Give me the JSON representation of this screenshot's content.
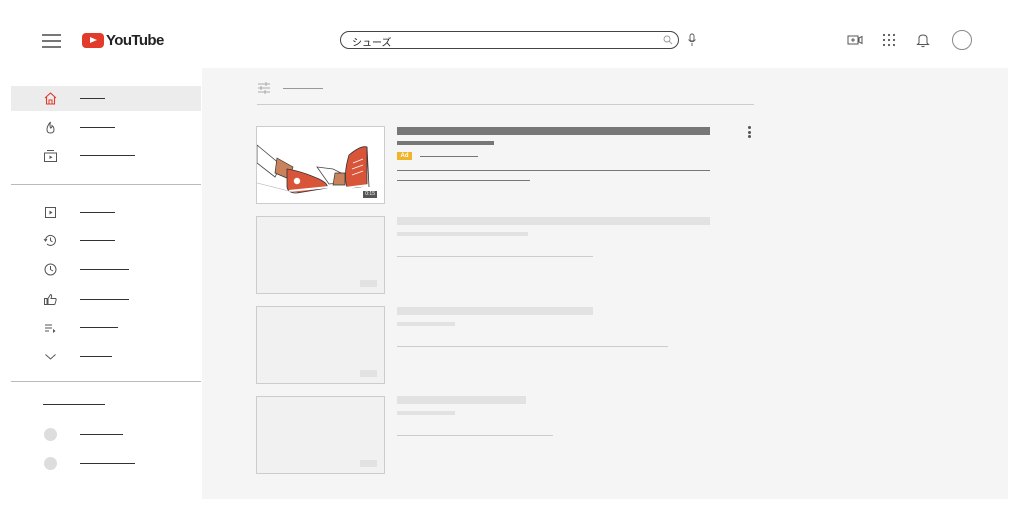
{
  "header": {
    "logo_text": "YouTube",
    "search_query": "シューズ"
  },
  "icons": {
    "menu": "hamburger-menu-icon",
    "search": "search-icon",
    "mic": "mic-icon",
    "create": "create-video-icon",
    "apps": "apps-grid-icon",
    "notifications": "bell-icon",
    "account": "avatar"
  },
  "sidebar": {
    "items": [
      {
        "icon": "home-icon",
        "active": true
      },
      {
        "icon": "trending-icon"
      },
      {
        "icon": "subscriptions-icon"
      },
      {
        "icon": "library-icon"
      },
      {
        "icon": "history-icon"
      },
      {
        "icon": "watch-later-icon"
      },
      {
        "icon": "liked-videos-icon"
      },
      {
        "icon": "playlist-icon"
      },
      {
        "icon": "show-more-icon"
      }
    ]
  },
  "feed": {
    "ad": {
      "tag": "Ad",
      "duration": "0:15"
    }
  },
  "colors": {
    "brand_red": "#e23a2b",
    "ad_tag": "#f0b429",
    "shoe_red": "#d9553a",
    "leg_brown": "#c9825b"
  }
}
